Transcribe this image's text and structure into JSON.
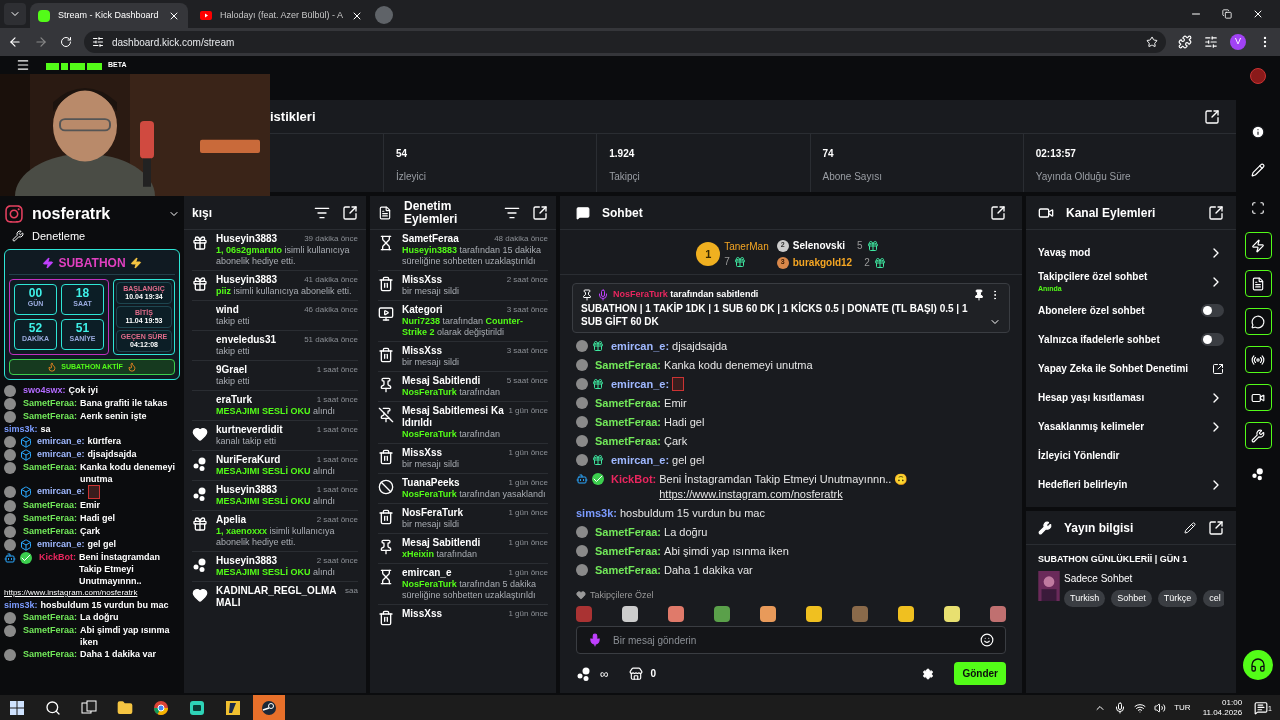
{
  "browser": {
    "tabs": [
      {
        "title": "Stream - Kick Dashboard",
        "kind": "kick",
        "selected": true
      },
      {
        "title": "Halodayı (feat. Azer Bülbül) - A",
        "kind": "youtube",
        "selected": false
      }
    ],
    "url": "dashboard.kick.com/stream",
    "profile": "V"
  },
  "header": {
    "beta": "BETA"
  },
  "stats": {
    "title": "istikleri",
    "items": [
      {
        "value": "54",
        "label": "İzleyici"
      },
      {
        "value": "1.924",
        "label": "Takipçi"
      },
      {
        "value": "74",
        "label": "Abone Sayısı"
      },
      {
        "value": "02:13:57",
        "label": "Yayında Olduğu Süre"
      }
    ]
  },
  "overlay": {
    "instagram": "nosferatrk",
    "moderation": "Denetleme",
    "subathon": {
      "title": "SUBATHON",
      "counters": [
        {
          "value": "00",
          "unit": "GÜN"
        },
        {
          "value": "18",
          "unit": "SAAT"
        },
        {
          "value": "52",
          "unit": "DAKİKA"
        },
        {
          "value": "51",
          "unit": "SANİYE"
        }
      ],
      "times": [
        {
          "label": "BAŞLANGIÇ",
          "value": "10.04 19:34"
        },
        {
          "label": "BİTİŞ",
          "value": "11.04 19:53"
        },
        {
          "label": "GEÇEN SÜRE",
          "value": "04:12:08"
        }
      ],
      "status": "SUBATHON AKTİF"
    },
    "chat": [
      {
        "user": "swo4swx:",
        "text": "Çok iyi",
        "color": "#b36bff",
        "badges": [
          {
            "kind": "avatar"
          }
        ]
      },
      {
        "user": "SametFeraa:",
        "text": "Bana grafiti ile takas",
        "color": "#72e85a",
        "badges": [
          {
            "kind": "avatar"
          }
        ]
      },
      {
        "user": "SametFeraa:",
        "text": "Aerık senin işte",
        "color": "#72e85a",
        "badges": [
          {
            "kind": "avatar"
          }
        ]
      },
      {
        "user": "sims3k:",
        "text": "sa",
        "color": "#7c9cff"
      },
      {
        "user": "emircan_e:",
        "text": "kürtfera",
        "color": "#9fb8ff",
        "badges": [
          {
            "kind": "avatar"
          },
          {
            "kind": "cube"
          }
        ]
      },
      {
        "user": "emircan_e:",
        "text": "djsajdsajda",
        "color": "#9fb8ff",
        "badges": [
          {
            "kind": "avatar"
          },
          {
            "kind": "cube"
          }
        ]
      },
      {
        "user": "SametFeraa:",
        "text": "Kanka kodu denemeyi unutma",
        "color": "#72e85a",
        "badges": [
          {
            "kind": "avatar"
          }
        ]
      },
      {
        "user": "emircan_e:",
        "emote": true,
        "color": "#9fb8ff",
        "badges": [
          {
            "kind": "avatar"
          },
          {
            "kind": "cube"
          }
        ]
      },
      {
        "user": "SametFeraa:",
        "text": "Emir",
        "color": "#72e85a",
        "badges": [
          {
            "kind": "avatar"
          }
        ]
      },
      {
        "user": "SametFeraa:",
        "text": "Hadi gel",
        "color": "#72e85a",
        "badges": [
          {
            "kind": "avatar"
          }
        ]
      },
      {
        "user": "SametFeraa:",
        "text": "Çark",
        "color": "#72e85a",
        "badges": [
          {
            "kind": "avatar"
          }
        ]
      },
      {
        "user": "emircan_e:",
        "text": "gel gel",
        "color": "#9fb8ff",
        "badges": [
          {
            "kind": "avatar"
          },
          {
            "kind": "cube"
          }
        ]
      },
      {
        "user": "KickBot:",
        "text": "Beni İnstagramdan Takip Etmeyi Unutmayınnn..",
        "link": "https://www.instagram.com/nosferatrk",
        "color": "#e8265e",
        "badges": [
          {
            "kind": "bot"
          },
          {
            "kind": "verified"
          }
        ]
      },
      {
        "user": "sims3k:",
        "text": "hosbuldum 15 vurdun bu mac",
        "color": "#7c9cff"
      },
      {
        "user": "SametFeraa:",
        "text": "La doğru",
        "color": "#72e85a",
        "badges": [
          {
            "kind": "avatar"
          }
        ]
      },
      {
        "user": "SametFeraa:",
        "text": "Abi şimdi yap ısınma iken",
        "color": "#72e85a",
        "badges": [
          {
            "kind": "avatar"
          }
        ]
      },
      {
        "user": "SametFeraa:",
        "text": "Daha 1 dakika var",
        "color": "#72e85a",
        "badges": [
          {
            "kind": "avatar"
          }
        ]
      }
    ]
  },
  "activity": {
    "title": "kışı",
    "items": [
      {
        "kind": "gift",
        "name": "Huseyin3883",
        "time": "39 dakika önce",
        "detail": [
          {
            "text": "1, 06s2gmaruto",
            "green": true
          },
          {
            "text": " isimli kullanıcıya abonelik hediye etti.",
            "green": false
          }
        ]
      },
      {
        "kind": "gift",
        "name": "Huseyin3883",
        "time": "41 dakika önce",
        "detail": [
          {
            "text": "piiz",
            "green": true
          },
          {
            "text": " isimli kullanıcıya abonelik etti.",
            "green": false
          }
        ]
      },
      {
        "kind": "none",
        "name": "wind",
        "time": "46 dakika önce",
        "detail": [
          {
            "text": "takip etti",
            "green": false
          }
        ]
      },
      {
        "kind": "none",
        "name": "enveledus31",
        "time": "51 dakika önce",
        "detail": [
          {
            "text": "takip etti",
            "green": false
          }
        ]
      },
      {
        "kind": "none",
        "name": "9Grael",
        "time": "1 saat önce",
        "detail": [
          {
            "text": "takip etti",
            "green": false
          }
        ]
      },
      {
        "kind": "none",
        "name": "eraTurk",
        "time": "1 saat önce",
        "detail": [
          {
            "text": "MESAJIMI SESLİ OKU",
            "green": true
          },
          {
            "text": " alındı",
            "green": false
          }
        ]
      },
      {
        "kind": "follow",
        "name": "kurtneverdidit",
        "time": "1 saat önce",
        "detail": [
          {
            "text": "kanalı takip etti",
            "green": false
          }
        ]
      },
      {
        "kind": "points",
        "name": "NuriFeraKurd",
        "time": "1 saat önce",
        "detail": [
          {
            "text": "MESAJIMI SESLİ OKU",
            "green": true
          },
          {
            "text": " alındı",
            "green": false
          }
        ]
      },
      {
        "kind": "points",
        "name": "Huseyin3883",
        "time": "1 saat önce",
        "detail": [
          {
            "text": "MESAJIMI SESLİ OKU",
            "green": true
          },
          {
            "text": " alındı",
            "green": false
          }
        ]
      },
      {
        "kind": "gift",
        "name": "Apelia",
        "time": "2 saat önce",
        "detail": [
          {
            "text": "1, xaenoxxx",
            "green": true
          },
          {
            "text": " isimli kullanıcıya abonelik hediye etti.",
            "green": false
          }
        ]
      },
      {
        "kind": "points",
        "name": "Huseyin3883",
        "time": "2 saat önce",
        "detail": [
          {
            "text": "MESAJIMI SESLİ OKU",
            "green": true
          },
          {
            "text": " alındı",
            "green": false
          }
        ]
      },
      {
        "kind": "follow",
        "name": "KADINLAR_REGL_OLMAMALI",
        "time": "saa"
      }
    ]
  },
  "moderation": {
    "title": "Denetim Eylemleri",
    "items": [
      {
        "kind": "timeout",
        "name": "SametFeraa",
        "time": "48 dakika önce",
        "detail": [
          {
            "text": "Huseyin3883",
            "green": true
          },
          {
            "text": " tarafından 15 dakika süreliğine sohbetten uzaklaştırıldı",
            "green": false
          }
        ]
      },
      {
        "kind": "delete",
        "name": "MissXss",
        "time": "2 saat önce",
        "detail": [
          {
            "text": "bir mesajı sildi",
            "green": false
          }
        ]
      },
      {
        "kind": "category",
        "name": "Kategori",
        "time": "3 saat önce",
        "detail": [
          {
            "text": "Nuri7238",
            "green": true
          },
          {
            "text": " tarafından ",
            "green": false
          },
          {
            "text": "Counter-Strike 2",
            "green": true
          },
          {
            "text": " olarak değiştirildi",
            "green": false
          }
        ]
      },
      {
        "kind": "delete",
        "name": "MissXss",
        "time": "3 saat önce",
        "detail": [
          {
            "text": "bir mesajı sildi",
            "green": false
          }
        ]
      },
      {
        "kind": "pin",
        "name": "Mesaj Sabitlendi",
        "time": "5 saat önce",
        "detail": [
          {
            "text": "NosFeraTurk",
            "green": true
          },
          {
            "text": " tarafından",
            "green": false
          }
        ]
      },
      {
        "kind": "unpin",
        "name": "Mesaj Sabitlemesi Kaldırıldı",
        "time": "1 gün önce",
        "detail": [
          {
            "text": "NosFeraTurk",
            "green": true
          },
          {
            "text": " tarafından",
            "green": false
          }
        ]
      },
      {
        "kind": "delete",
        "name": "MissXss",
        "time": "1 gün önce",
        "detail": [
          {
            "text": "bir mesajı sildi",
            "green": false
          }
        ]
      },
      {
        "kind": "ban",
        "name": "TuanaPeeks",
        "time": "1 gün önce",
        "detail": [
          {
            "text": "NosFeraTurk",
            "green": true
          },
          {
            "text": " tarafından yasaklandı",
            "green": false
          }
        ]
      },
      {
        "kind": "delete",
        "name": "NosFeraTurk",
        "time": "1 gün önce",
        "detail": [
          {
            "text": "bir mesajı sildi",
            "green": false
          }
        ]
      },
      {
        "kind": "pin",
        "name": "Mesaj Sabitlendi",
        "time": "1 gün önce",
        "detail": [
          {
            "text": "xHeixin",
            "green": true
          },
          {
            "text": " tarafından",
            "green": false
          }
        ]
      },
      {
        "kind": "timeout",
        "name": "emircan_e",
        "time": "1 gün önce",
        "detail": [
          {
            "text": "NosFeraTurk",
            "green": true
          },
          {
            "text": " tarafından 5 dakika süreliğine sohbetten uzaklaştırıldı",
            "green": false
          }
        ]
      },
      {
        "kind": "delete",
        "name": "MissXss",
        "time": "1 gün önce"
      }
    ]
  },
  "chat": {
    "title": "Sohbet",
    "leaders": [
      {
        "rank": "1",
        "name": "TanerMan",
        "count": "7",
        "color": "#f5a623"
      },
      {
        "rank": "2",
        "name": "Selenovski",
        "count": "5",
        "color": "#ffffff"
      },
      {
        "rank": "3",
        "name": "burakgold12",
        "count": "2",
        "color": "#f5a623"
      }
    ],
    "pinned": {
      "user": "NosFeraTurk",
      "by": " tarafından sabitlendi",
      "text": "SUBATHON | 1 TAKİP 1DK | 1 SUB 60 DK | 1 KİCKS 0.5 | DONATE (TL BAŞI) 0.5 | 1 SUB GİFT 60 DK"
    },
    "messages": [
      {
        "user": "emircan_e:",
        "text": "djsajdsajda",
        "color": "#9fb8ff",
        "badges": [
          {
            "kind": "avatar"
          },
          {
            "kind": "gift"
          }
        ]
      },
      {
        "user": "SametFeraa:",
        "text": "Kanka kodu denemeyi unutma",
        "color": "#72e85a",
        "badges": [
          {
            "kind": "avatar"
          }
        ]
      },
      {
        "user": "emircan_e:",
        "emote": true,
        "color": "#9fb8ff",
        "badges": [
          {
            "kind": "avatar"
          },
          {
            "kind": "gift"
          }
        ]
      },
      {
        "user": "SametFeraa:",
        "text": "Emir",
        "color": "#72e85a",
        "badges": [
          {
            "kind": "avatar"
          }
        ]
      },
      {
        "user": "SametFeraa:",
        "text": "Hadi gel",
        "color": "#72e85a",
        "badges": [
          {
            "kind": "avatar"
          }
        ]
      },
      {
        "user": "SametFeraa:",
        "text": "Çark",
        "color": "#72e85a",
        "badges": [
          {
            "kind": "avatar"
          }
        ]
      },
      {
        "user": "emircan_e:",
        "text": "gel gel",
        "color": "#9fb8ff",
        "badges": [
          {
            "kind": "avatar"
          },
          {
            "kind": "gift"
          }
        ]
      },
      {
        "user": "KickBot:",
        "text": "Beni İnstagramdan Takip Etmeyi Unutmayınnn.. 🙃",
        "link": "https://www.instagram.com/nosferatrk",
        "color": "#e8265e",
        "badges": [
          {
            "kind": "bot"
          },
          {
            "kind": "verified"
          }
        ]
      },
      {
        "user": "sims3k:",
        "text": "hosbuldum 15 vurdun bu mac",
        "color": "#7c9cff"
      },
      {
        "user": "SametFeraa:",
        "text": "La doğru",
        "color": "#72e85a",
        "badges": [
          {
            "kind": "avatar"
          }
        ]
      },
      {
        "user": "SametFeraa:",
        "text": "Abi şimdi yap ısınma iken",
        "color": "#72e85a",
        "badges": [
          {
            "kind": "avatar"
          }
        ]
      },
      {
        "user": "SametFeraa:",
        "text": "Daha 1 dakika var",
        "color": "#72e85a",
        "badges": [
          {
            "kind": "avatar"
          }
        ]
      }
    ],
    "emote_set": "Takipçilere Özel",
    "placeholder": "Bir mesaj gönderin",
    "points": "∞",
    "drops": "0",
    "send": "Gönder"
  },
  "channel_actions": {
    "title": "Kanal Eylemleri",
    "items": [
      {
        "kind": "chevron",
        "label": "Yavaş mod"
      },
      {
        "kind": "chevron",
        "label": "Takipçilere özel sohbet",
        "sub": "Anında"
      },
      {
        "kind": "toggle",
        "label": "Abonelere özel sohbet",
        "on": false
      },
      {
        "kind": "toggle",
        "label": "Yalnızca ifadelerle sohbet",
        "on": false
      },
      {
        "kind": "external",
        "label": "Yapay Zeka ile Sohbet Denetimi"
      },
      {
        "kind": "chevron",
        "label": "Hesap yaşı kısıtlaması"
      },
      {
        "kind": "chevron",
        "label": "Yasaklanmış kelimeler"
      },
      {
        "kind": "plain",
        "label": "İzleyici Yönlendir"
      },
      {
        "kind": "chevron",
        "label": "Hedefleri belirleyin"
      }
    ]
  },
  "stream_info": {
    "title": "Yayın bilgisi",
    "stream_title": "SUBATHON GÜNLÜKLERİİ | GÜN 1",
    "category": "Sadece Sohbet",
    "tags": [
      "Turkish",
      "Sohbet",
      "Türkçe",
      "cel"
    ]
  },
  "rail": [
    {
      "kind": "info",
      "highlighted": false
    },
    {
      "kind": "pencil",
      "highlighted": false
    },
    {
      "kind": "scan",
      "highlighted": false
    },
    {
      "kind": "bolt",
      "highlighted": true
    },
    {
      "kind": "doc",
      "highlighted": true
    },
    {
      "kind": "chat",
      "highlighted": true
    },
    {
      "kind": "radio",
      "highlighted": true
    },
    {
      "kind": "video",
      "highlighted": true
    },
    {
      "kind": "wrench",
      "highlighted": true
    },
    {
      "kind": "dots",
      "highlighted": false
    }
  ],
  "taskbar": {
    "apps": [
      {
        "kind": "windows",
        "selected": false
      },
      {
        "kind": "search",
        "selected": false
      },
      {
        "kind": "taskview",
        "selected": false
      },
      {
        "kind": "folder",
        "selected": false
      },
      {
        "kind": "chrome",
        "selected": false
      },
      {
        "kind": "app",
        "selected": false
      },
      {
        "kind": "game",
        "selected": false
      },
      {
        "kind": "steam",
        "selected": true
      }
    ],
    "language": "TUR",
    "time": "01:00",
    "date": "11.04.2026",
    "notifications": "1"
  }
}
